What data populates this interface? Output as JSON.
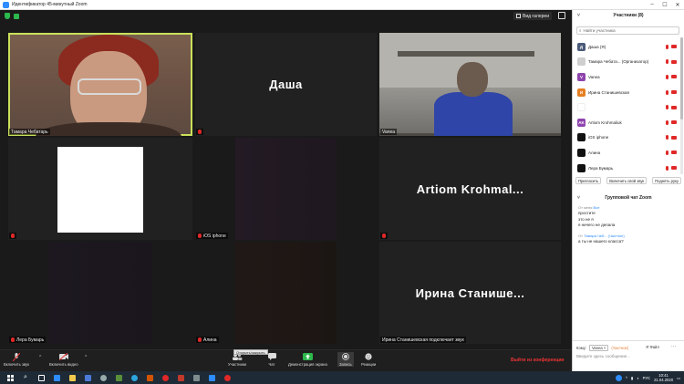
{
  "window": {
    "title": "Идентификатор 45-минутный Zoom"
  },
  "view": {
    "gallery_label": "Вид галереи"
  },
  "tiles": [
    {
      "name": "Тамара Чебатарь",
      "big": ""
    },
    {
      "name": "",
      "big": "Даша"
    },
    {
      "name": "Vanea",
      "big": ""
    },
    {
      "name": "",
      "big": ""
    },
    {
      "name": "iOS iphone",
      "big": ""
    },
    {
      "name": "",
      "big": "Artiom  Krohmal..."
    },
    {
      "name": "Лера Бумарь",
      "big": ""
    },
    {
      "name": "Алина",
      "big": ""
    },
    {
      "name": "Ирина Станишевская подключает звук",
      "big": "Ирина  Станише..."
    }
  ],
  "toolbar": {
    "mic": "Включить звук",
    "video": "Включить видео",
    "participants": "Участники",
    "participants_count": "12",
    "chat": "Чат",
    "share": "Демонстрация экрана",
    "record": "Запись",
    "reactions": "Реакции",
    "leave": "Выйти из конференции",
    "tooltip": "Открыть/закрыть"
  },
  "panel": {
    "title": "Участники (8)",
    "search_placeholder": "Найти участника",
    "participants": [
      {
        "initial": "Д",
        "name": "Даша (Я)",
        "color": "#4a5a78"
      },
      {
        "initial": "",
        "name": "Тамара Чебата... (Организатор)",
        "color": "#cfcfcf"
      },
      {
        "initial": "V",
        "name": "Vanea",
        "color": "#8e44ad"
      },
      {
        "initial": "И",
        "name": "Ирина Станишевская",
        "color": "#e67e22"
      },
      {
        "initial": "",
        "name": "",
        "color": "#ffffff"
      },
      {
        "initial": "AK",
        "name": "Artiom Krohmaliuk",
        "color": "#8e44ad"
      },
      {
        "initial": "",
        "name": "iOS iphone",
        "color": "#111111"
      },
      {
        "initial": "",
        "name": "Алина",
        "color": "#111111"
      },
      {
        "initial": "",
        "name": "Лера Бумарь",
        "color": "#111111"
      }
    ],
    "buttons": [
      "Пригласить",
      "Включить свой звук",
      "Поднять руку"
    ]
  },
  "chat": {
    "title": "Групповой чат Zoom",
    "messages": [
      {
        "from": "От меня",
        "to": "Все",
        "lines": [
          "простите",
          "это не я",
          "я ничего не делала"
        ]
      },
      {
        "from": "От",
        "to": "Тамара Чеб... (Частное)",
        "lines": [
          "а ты не нашего класса?"
        ]
      }
    ],
    "to_label": "Кому:",
    "to_value": "Vanea",
    "to_note": "(Частное)",
    "file_label": "Файл",
    "input_placeholder": "Введите здесь сообщение..."
  },
  "taskbar": {
    "lang": "РУС",
    "time": "10:41",
    "date": "21.04.2020"
  }
}
